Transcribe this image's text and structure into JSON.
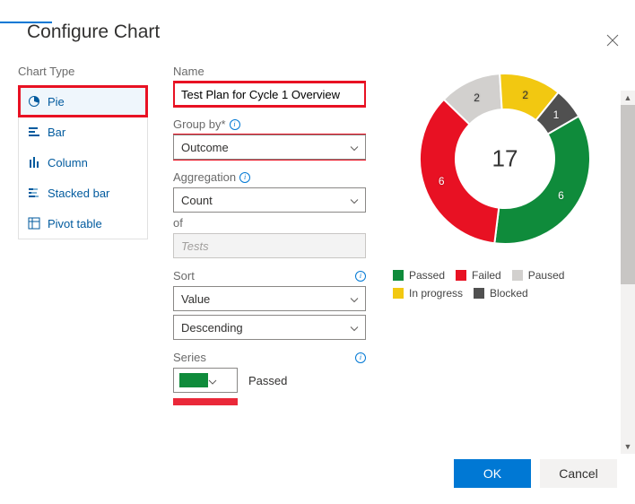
{
  "dialog": {
    "title": "Configure Chart",
    "ok_label": "OK",
    "cancel_label": "Cancel"
  },
  "chart_type": {
    "label": "Chart Type",
    "options": [
      {
        "id": "pie",
        "label": "Pie",
        "selected": true
      },
      {
        "id": "bar",
        "label": "Bar",
        "selected": false
      },
      {
        "id": "column",
        "label": "Column",
        "selected": false
      },
      {
        "id": "stacked-bar",
        "label": "Stacked bar",
        "selected": false
      },
      {
        "id": "pivot-table",
        "label": "Pivot table",
        "selected": false
      }
    ]
  },
  "form": {
    "name_label": "Name",
    "name_value": "Test Plan for Cycle 1 Overview",
    "groupby_label": "Group by*",
    "groupby_value": "Outcome",
    "aggregation_label": "Aggregation",
    "aggregation_value": "Count",
    "of_label": "of",
    "of_value": "Tests",
    "sort_label": "Sort",
    "sort_field": "Value",
    "sort_dir": "Descending",
    "series_label": "Series",
    "series": [
      {
        "label": "Passed",
        "color": "#0f8b3b"
      },
      {
        "label": "",
        "color": "#e81123"
      }
    ]
  },
  "legend": [
    {
      "label": "Passed",
      "color": "#0f8b3b"
    },
    {
      "label": "Failed",
      "color": "#e81123"
    },
    {
      "label": "Paused",
      "color": "#d2d0ce"
    },
    {
      "label": "In progress",
      "color": "#f2c811"
    },
    {
      "label": "Blocked",
      "color": "#505050"
    }
  ],
  "chart_data": {
    "type": "pie",
    "title": "",
    "total": 17,
    "data_labels_visible": true,
    "series": [
      {
        "name": "Passed",
        "value": 6,
        "color": "#0f8b3b"
      },
      {
        "name": "Failed",
        "value": 6,
        "color": "#e81123"
      },
      {
        "name": "Paused",
        "value": 2,
        "color": "#d2d0ce"
      },
      {
        "name": "In progress",
        "value": 2,
        "color": "#f2c811"
      },
      {
        "name": "Blocked",
        "value": 1,
        "color": "#505050"
      }
    ]
  }
}
